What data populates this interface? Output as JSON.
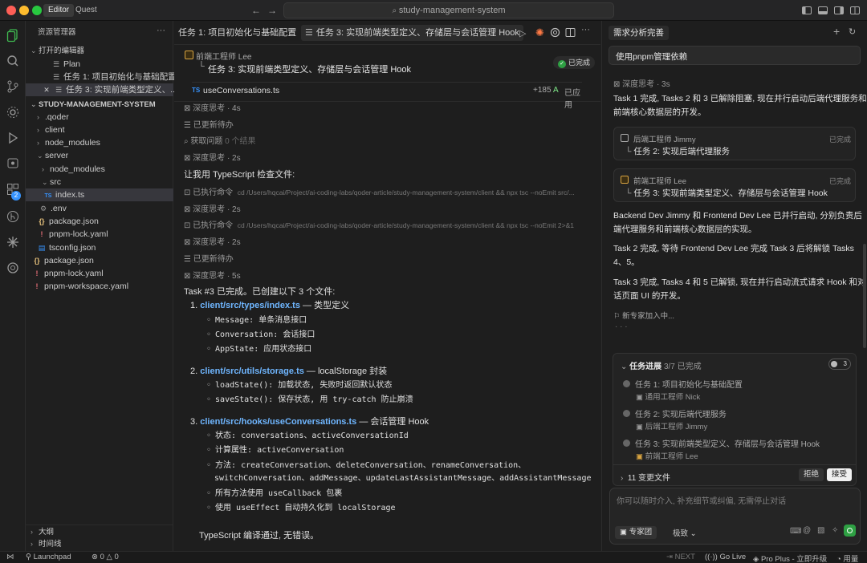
{
  "titlebar": {
    "segments": [
      "Editor",
      "Quest"
    ],
    "search": "study-management-system",
    "nav_back": "←",
    "nav_forward": "→"
  },
  "sidebar": {
    "title": "资源管理器",
    "open_editors": "打开的编辑器",
    "open_items": [
      {
        "label": "Plan"
      },
      {
        "label": "任务 1: 项目初始化与基础配置"
      },
      {
        "label": "任务 3: 实现前端类型定义、..."
      }
    ],
    "project": "STUDY-MANAGEMENT-SYSTEM",
    "tree": [
      {
        "label": ".qoder",
        "type": "folder"
      },
      {
        "label": "client",
        "type": "folder"
      },
      {
        "label": "node_modules",
        "type": "folder"
      },
      {
        "label": "server",
        "type": "folder-open"
      },
      {
        "label": "node_modules",
        "type": "folder"
      },
      {
        "label": "src",
        "type": "folder-open"
      },
      {
        "label": "index.ts",
        "type": "ts"
      },
      {
        "label": ".env",
        "type": "env"
      },
      {
        "label": "package.json",
        "type": "json"
      },
      {
        "label": "pnpm-lock.yaml",
        "type": "yaml"
      },
      {
        "label": "tsconfig.json",
        "type": "tsconfig"
      },
      {
        "label": "package.json",
        "type": "json"
      },
      {
        "label": "pnpm-lock.yaml",
        "type": "yaml"
      },
      {
        "label": "pnpm-workspace.yaml",
        "type": "yaml"
      }
    ],
    "outline": "大纲",
    "timeline": "时间线",
    "badge": "2"
  },
  "editor": {
    "tab1": "任务 1: 项目初始化与基础配置",
    "tab2": "任务 3: 实现前端类型定义、存储层与会话管理 Hook",
    "agent_role": "前端工程师 Lee",
    "task_title": "任务 3: 实现前端类型定义、存储层与会话管理 Hook",
    "done_badge": "已完成",
    "file_row": {
      "name": "useConversations.ts",
      "added": "+185",
      "flag": "A",
      "status": "已应用"
    },
    "log": [
      {
        "text": "深度思考 · 4s"
      },
      {
        "text": "已更新待办"
      },
      {
        "text": "获取问题",
        "extra": "0 个结果"
      },
      {
        "text": "深度思考 · 2s"
      }
    ],
    "check_line": "让我用 TypeScript 检查文件:",
    "cmd1_label": "已执行命令",
    "cmd1": "cd /Users/hqcai/Project/ai-coding-labs/qoder-article/study-management-system/client && npx tsc --noEmit src/...",
    "think2": "深度思考 · 2s",
    "cmd2_label": "已执行命令",
    "cmd2": "cd /Users/hqcai/Project/ai-coding-labs/qoder-article/study-management-system/client && npx tsc --noEmit 2>&1",
    "think3": "深度思考 · 2s",
    "todo2": "已更新待办",
    "think4": "深度思考 · 5s",
    "summary": "Task #3 已完成。已创建以下 3 个文件:",
    "file1": {
      "num": "1.",
      "path": "client/src/types/index.ts",
      "desc": "— 类型定义",
      "items": [
        "Message: 单条消息接口",
        "Conversation: 会话接口",
        "AppState: 应用状态接口"
      ]
    },
    "file2": {
      "num": "2.",
      "path": "client/src/utils/storage.ts",
      "desc": "— localStorage 封装",
      "items": [
        "loadState(): 加载状态, 失败时返回默认状态",
        "saveState(): 保存状态, 用 try-catch 防止崩溃"
      ]
    },
    "file3": {
      "num": "3.",
      "path": "client/src/hooks/useConversations.ts",
      "desc": "— 会话管理 Hook",
      "items": [
        "状态: conversations、activeConversationId",
        "计算属性: activeConversation",
        "方法: createConversation、deleteConversation、renameConversation、",
        "switchConversation、addMessage、updateLastAssistantMessage、addAssistantMessage",
        "所有方法使用 useCallback 包裹",
        "使用 useEffect 自动持久化到 localStorage"
      ]
    },
    "final": "TypeScript 编译通过, 无错误。"
  },
  "chat": {
    "tab": "需求分析完善",
    "prompt": "使用pnpm管理依赖",
    "think": "深度思考 · 3s",
    "para1": [
      "Task 1 完成, Tasks 2 和 3 已解除阻塞, 现在并行启动后端代理服务和",
      "前端核心数据层的开发。"
    ],
    "agent1": {
      "role": "后端工程师 Jimmy",
      "status": "已完成",
      "task": "任务 2: 实现后端代理服务"
    },
    "agent2": {
      "role": "前端工程师 Lee",
      "status": "已完成",
      "task": "任务 3: 实现前端类型定义、存储层与会话管理 Hook"
    },
    "para2": [
      "Backend Dev Jimmy 和 Frontend Dev Lee 已并行启动, 分别负责后",
      "端代理服务和前端核心数据层的实现。"
    ],
    "para3": [
      "Task 2 完成, 等待 Frontend Dev Lee 完成 Task 3 后将解锁 Tasks",
      "4、5。"
    ],
    "para4": [
      "Task 3 完成, Tasks 4 和 5 已解锁, 现在并行启动流式请求 Hook 和对",
      "话页面 UI 的开发。"
    ],
    "joining": "新专家加入中...",
    "progress": {
      "title": "任务进展",
      "count": "3/7 已完成",
      "pill": "3",
      "fraction": 0.4286
    },
    "tasks": [
      {
        "label": "任务 1: 项目初始化与基础配置",
        "owner": "通用工程师 Nick"
      },
      {
        "label": "任务 2: 实现后端代理服务",
        "owner": "后端工程师 Jimmy"
      },
      {
        "label": "任务 3: 实现前端类型定义、存储层与会话管理 Hook",
        "owner": "前端工程师 Lee"
      }
    ],
    "changes": "11 变更文件",
    "reject": "拒绝",
    "accept": "接受",
    "input_placeholder": "你可以随时介入, 补充细节或纠偏, 无需停止对话",
    "team": "专家团",
    "level": "极致"
  },
  "status": {
    "launchpad": "Launchpad",
    "errors": "0",
    "warnings": "0",
    "next": "NEXT",
    "golive": "Go Live",
    "plan": "Pro Plus - 立即升级",
    "usage": "用量"
  },
  "colors": {
    "accent": "#3794ff",
    "link": "#6fb6ff",
    "green": "#2ea043"
  }
}
